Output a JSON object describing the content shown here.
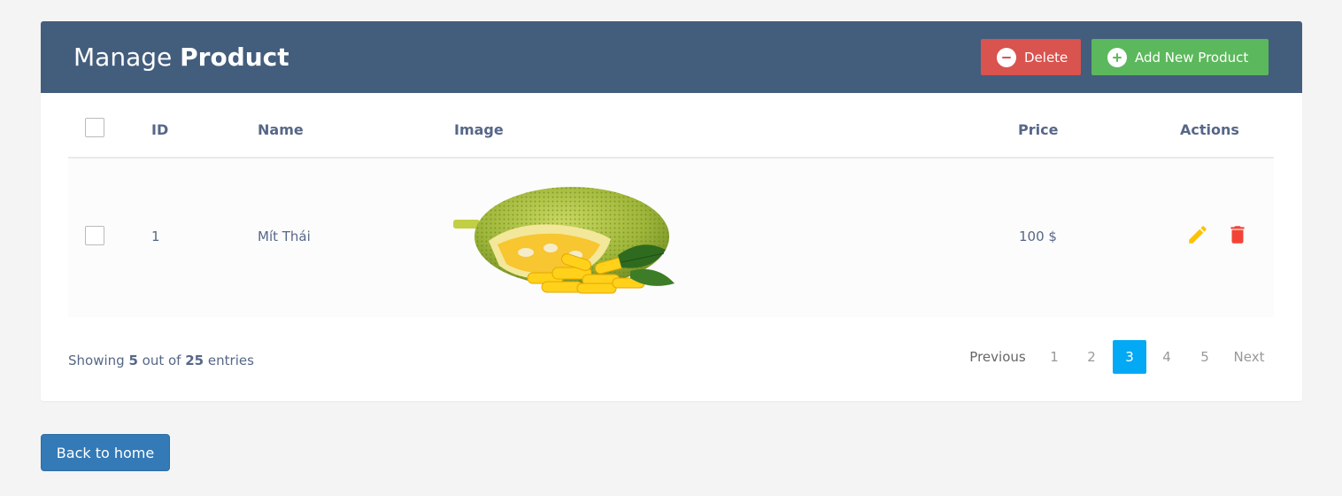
{
  "header": {
    "title_light": "Manage",
    "title_bold": "Product",
    "delete_label": "Delete",
    "add_label": "Add New Product"
  },
  "table": {
    "columns": [
      "ID",
      "Name",
      "Image",
      "Price",
      "Actions"
    ],
    "rows": [
      {
        "id": "1",
        "name": "Mít Thái",
        "price": "100 $",
        "image": "jackfruit"
      }
    ]
  },
  "footer": {
    "showing_prefix": "Showing",
    "shown": "5",
    "out_of": "out of",
    "total": "25",
    "entries": "entries"
  },
  "pagination": {
    "previous": "Previous",
    "pages": [
      "1",
      "2",
      "3",
      "4",
      "5"
    ],
    "active_page": "3",
    "next": "Next"
  },
  "back_button": "Back to home",
  "colors": {
    "header_bg": "#435d7d",
    "delete": "#d9534f",
    "add": "#5cb85c",
    "active_page": "#03a9f4",
    "edit_icon": "#ffc107",
    "delete_icon": "#f44336",
    "back_button": "#337ab7"
  }
}
